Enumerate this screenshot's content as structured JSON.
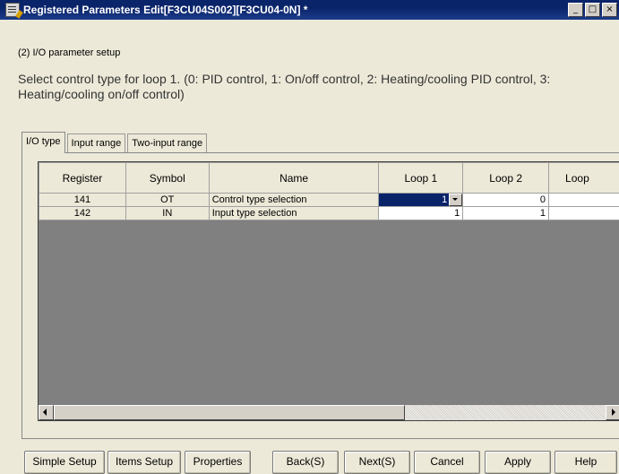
{
  "window": {
    "title": "Registered Parameters Edit[F3CU04S002][F3CU04-0N] *",
    "minimize": "_",
    "maximize": "□",
    "close": "×"
  },
  "section_title": "(2) I/O parameter setup",
  "description": "Select control type for loop 1. (0: PID control, 1: On/off control, 2: Heating/cooling PID control, 3: Heating/cooling on/off control)",
  "tabs": [
    {
      "label": "I/O type",
      "active": true
    },
    {
      "label": "Input range",
      "active": false
    },
    {
      "label": "Two-input range",
      "active": false
    }
  ],
  "table": {
    "columns": [
      "Register",
      "Symbol",
      "Name",
      "Loop 1",
      "Loop 2",
      "Loop"
    ],
    "rows": [
      {
        "register": "141",
        "symbol": "OT",
        "name": "Control type selection",
        "loop1": "1",
        "loop2": "0",
        "loop3": ""
      },
      {
        "register": "142",
        "symbol": "IN",
        "name": "Input type selection",
        "loop1": "1",
        "loop2": "1",
        "loop3": ""
      }
    ]
  },
  "buttons": {
    "simple_setup": "Simple Setup",
    "items_setup": "Items Setup",
    "properties": "Properties",
    "back": "Back(S)",
    "next": "Next(S)",
    "cancel": "Cancel",
    "apply": "Apply",
    "help": "Help"
  },
  "colors": {
    "titlebar": "#0a246a",
    "selection": "#0a246a",
    "grid_background": "#808080",
    "face": "#ece9d8"
  }
}
